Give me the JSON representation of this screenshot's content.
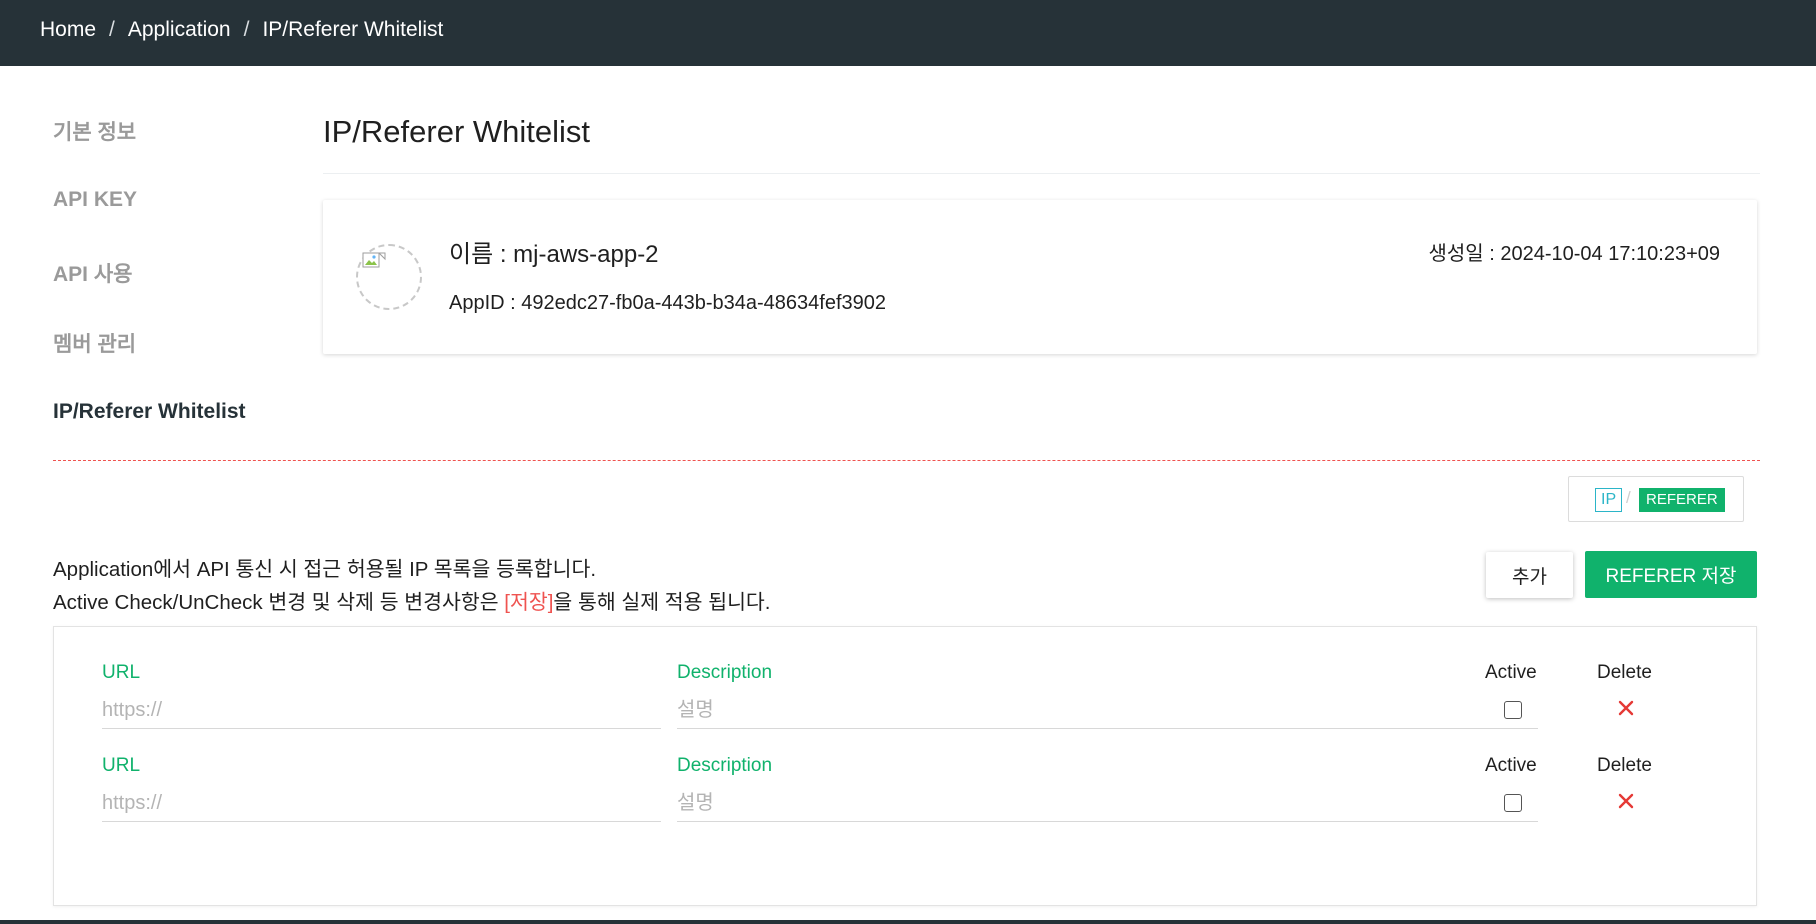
{
  "breadcrumb": {
    "items": [
      "Home",
      "Application",
      "IP/Referer Whitelist"
    ],
    "separator": "/"
  },
  "sidebar": {
    "items": [
      {
        "label": "기본 정보",
        "active": false
      },
      {
        "label": "API KEY",
        "active": false
      },
      {
        "label": "API 사용",
        "active": false
      },
      {
        "label": "멤버 관리",
        "active": false
      },
      {
        "label": "IP/Referer Whitelist",
        "active": true
      }
    ]
  },
  "page": {
    "title": "IP/Referer Whitelist"
  },
  "app": {
    "name": "이름 : mj-aws-app-2",
    "app_id": "AppID : 492edc27-fb0a-443b-b34a-48634fef3902",
    "created": "생성일 : 2024-10-04 17:10:23+09",
    "avatar_icon": "broken-image-icon"
  },
  "mode_toggle": {
    "ip_label": "IP",
    "separator": "/",
    "referer_label": "REFERER",
    "selected": "REFERER"
  },
  "description": {
    "line1": "Application에서 API 통신 시 접근 허용될 IP 목록을 등록합니다.",
    "line2_before": "Active Check/UnCheck 변경 및 삭제 등 변경사항은 ",
    "line2_highlight": "[저장]",
    "line2_after": "을 통해 실제 적용 됩니다."
  },
  "actions": {
    "add_label": "추가",
    "save_label": "REFERER 저장"
  },
  "whitelist": {
    "columns": {
      "url": "URL",
      "description": "Description",
      "active": "Active",
      "delete": "Delete"
    },
    "rows": [
      {
        "url": "",
        "url_placeholder": "https://",
        "description": "",
        "description_placeholder": "설명",
        "active": false
      },
      {
        "url": "",
        "url_placeholder": "https://",
        "description": "",
        "description_placeholder": "설명",
        "active": false
      }
    ]
  },
  "colors": {
    "topbar": "#263238",
    "accent_green": "#10b26c",
    "ip_cyan": "#2bb5c8",
    "highlight_red": "#ef5350",
    "delete_red": "#e53935",
    "nav_inactive": "#9a9a9a"
  },
  "icons": {
    "delete": "close-icon",
    "checkbox": "checkbox-icon"
  }
}
